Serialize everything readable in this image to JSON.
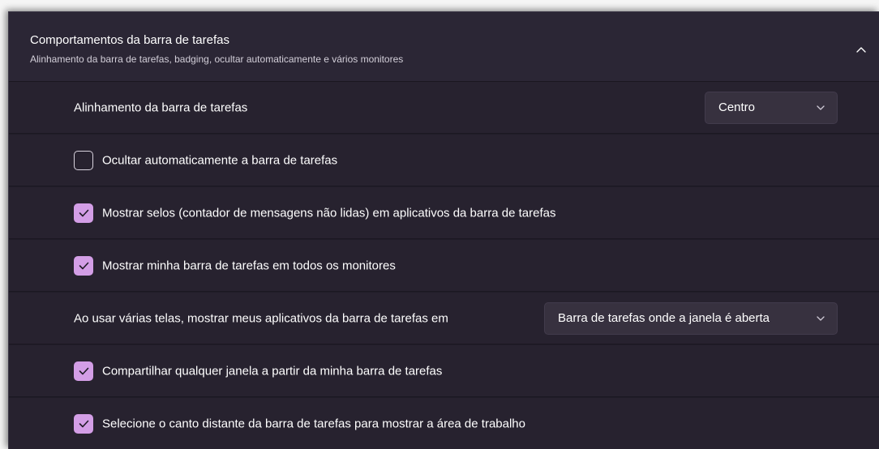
{
  "section": {
    "title": "Comportamentos da barra de tarefas",
    "subtitle": "Alinhamento da barra de tarefas, badging, ocultar automaticamente e vários monitores",
    "expanded": true
  },
  "alignment": {
    "label": "Alinhamento da barra de tarefas",
    "value": "Centro"
  },
  "auto_hide": {
    "label": "Ocultar automaticamente a barra de tarefas",
    "checked": false
  },
  "badges": {
    "label": "Mostrar selos (contador de mensagens não lidas) em aplicativos da barra de tarefas",
    "checked": true
  },
  "all_monitors": {
    "label": "Mostrar minha barra de tarefas em todos os monitores",
    "checked": true
  },
  "multi_display": {
    "label": "Ao usar várias telas, mostrar meus aplicativos da barra de tarefas em",
    "value": "Barra de tarefas onde a janela é aberta"
  },
  "share_window": {
    "label": "Compartilhar qualquer janela a partir da minha barra de tarefas",
    "checked": true
  },
  "far_corner": {
    "label": "Selecione o canto distante da barra de tarefas para mostrar a área de trabalho",
    "checked": true
  },
  "colors": {
    "accent": "#d39ee6",
    "background": "#201c28",
    "card": "#27222f",
    "header": "#2b2635"
  },
  "icons": {
    "collapse": "chevron-up-icon",
    "dropdown": "chevron-down-icon",
    "check": "checkmark-icon"
  }
}
